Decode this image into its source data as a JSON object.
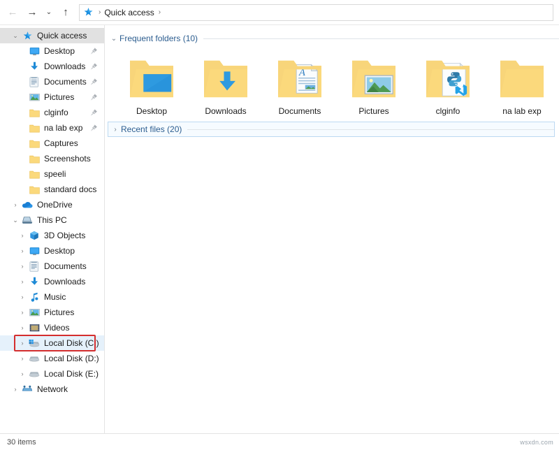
{
  "toolbar": {
    "back_label": "←",
    "forward_label": "→",
    "history_label": "⌄",
    "up_label": "↑"
  },
  "breadcrumb": {
    "icon": "quick-access-star-icon",
    "separator_1": "›",
    "text": "Quick access",
    "separator_2": "›"
  },
  "sidebar": {
    "items": [
      {
        "label": "Quick access",
        "icon": "star-icon",
        "level": 0,
        "chevron": "⌄",
        "pinned": false,
        "state": "selected-grey"
      },
      {
        "label": "Desktop",
        "icon": "desktop-icon",
        "level": 1,
        "chevron": "",
        "pinned": true,
        "state": ""
      },
      {
        "label": "Downloads",
        "icon": "downloads-icon",
        "level": 1,
        "chevron": "",
        "pinned": true,
        "state": ""
      },
      {
        "label": "Documents",
        "icon": "documents-icon",
        "level": 1,
        "chevron": "",
        "pinned": true,
        "state": ""
      },
      {
        "label": "Pictures",
        "icon": "pictures-icon",
        "level": 1,
        "chevron": "",
        "pinned": true,
        "state": ""
      },
      {
        "label": "clginfo",
        "icon": "folder-icon",
        "level": 1,
        "chevron": "",
        "pinned": true,
        "state": ""
      },
      {
        "label": "na lab exp",
        "icon": "folder-icon",
        "level": 1,
        "chevron": "",
        "pinned": true,
        "state": ""
      },
      {
        "label": "Captures",
        "icon": "folder-icon",
        "level": 1,
        "chevron": "",
        "pinned": false,
        "state": ""
      },
      {
        "label": "Screenshots",
        "icon": "folder-icon",
        "level": 1,
        "chevron": "",
        "pinned": false,
        "state": ""
      },
      {
        "label": "speeli",
        "icon": "folder-icon",
        "level": 1,
        "chevron": "",
        "pinned": false,
        "state": ""
      },
      {
        "label": "standard docs",
        "icon": "folder-icon",
        "level": 1,
        "chevron": "",
        "pinned": false,
        "state": ""
      },
      {
        "label": "OneDrive",
        "icon": "onedrive-cloud-icon",
        "level": 0,
        "chevron": "›",
        "pinned": false,
        "state": ""
      },
      {
        "label": "This PC",
        "icon": "this-pc-icon",
        "level": 0,
        "chevron": "⌄",
        "pinned": false,
        "state": ""
      },
      {
        "label": "3D Objects",
        "icon": "3d-objects-icon",
        "level": 1,
        "chevron": "›",
        "pinned": false,
        "state": ""
      },
      {
        "label": "Desktop",
        "icon": "desktop-icon",
        "level": 1,
        "chevron": "›",
        "pinned": false,
        "state": ""
      },
      {
        "label": "Documents",
        "icon": "documents-icon",
        "level": 1,
        "chevron": "›",
        "pinned": false,
        "state": ""
      },
      {
        "label": "Downloads",
        "icon": "downloads-icon",
        "level": 1,
        "chevron": "›",
        "pinned": false,
        "state": ""
      },
      {
        "label": "Music",
        "icon": "music-note-icon",
        "level": 1,
        "chevron": "›",
        "pinned": false,
        "state": ""
      },
      {
        "label": "Pictures",
        "icon": "pictures-icon",
        "level": 1,
        "chevron": "›",
        "pinned": false,
        "state": ""
      },
      {
        "label": "Videos",
        "icon": "videos-icon",
        "level": 1,
        "chevron": "›",
        "pinned": false,
        "state": ""
      },
      {
        "label": "Local Disk (C:)",
        "icon": "system-drive-icon",
        "level": 1,
        "chevron": "›",
        "pinned": false,
        "state": "selected-blue"
      },
      {
        "label": "Local Disk (D:)",
        "icon": "drive-icon",
        "level": 1,
        "chevron": "›",
        "pinned": false,
        "state": ""
      },
      {
        "label": "Local Disk (E:)",
        "icon": "drive-icon",
        "level": 1,
        "chevron": "›",
        "pinned": false,
        "state": ""
      },
      {
        "label": "Network",
        "icon": "network-icon",
        "level": 0,
        "chevron": "›",
        "pinned": false,
        "state": ""
      }
    ],
    "highlight": {
      "target": "Local Disk (C:)",
      "color": "#d42e2e"
    }
  },
  "content": {
    "frequent_folders": {
      "title": "Frequent folders (10)",
      "chevron": "⌄",
      "expanded": true,
      "tiles": [
        {
          "label": "Desktop",
          "icon": "folder-desktop-icon"
        },
        {
          "label": "Downloads",
          "icon": "folder-downloads-icon"
        },
        {
          "label": "Documents",
          "icon": "folder-documents-icon"
        },
        {
          "label": "Pictures",
          "icon": "folder-pictures-icon"
        },
        {
          "label": "clginfo",
          "icon": "folder-python-icon"
        },
        {
          "label": "na lab exp",
          "icon": "folder-plain-icon"
        }
      ]
    },
    "recent_files": {
      "title": "Recent files (20)",
      "chevron": "›",
      "expanded": false
    }
  },
  "statusbar": {
    "item_count": "30 items",
    "watermark": "wsxdn.com"
  },
  "colors": {
    "folder_yellow": "#fbd97c",
    "accent_blue": "#0078d7",
    "group_title": "#2c5d8f",
    "highlight_red": "#d42e2e",
    "selection_blue": "#e5f1fb",
    "selection_grey": "#e1e1e1"
  }
}
